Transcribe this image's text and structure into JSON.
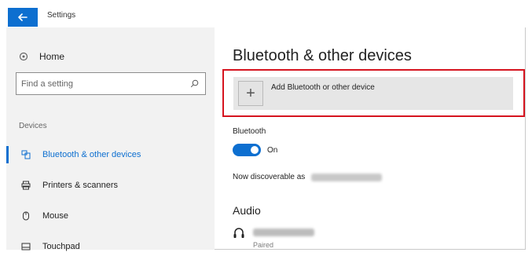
{
  "window": {
    "title": "Settings"
  },
  "sidebar": {
    "home_label": "Home",
    "search": {
      "placeholder": "Find a setting"
    },
    "section_title": "Devices",
    "items": [
      {
        "label": "Bluetooth & other devices",
        "icon": "bluetooth-devices-icon",
        "active": true
      },
      {
        "label": "Printers & scanners",
        "icon": "printer-icon",
        "active": false
      },
      {
        "label": "Mouse",
        "icon": "mouse-icon",
        "active": false
      },
      {
        "label": "Touchpad",
        "icon": "touchpad-icon",
        "active": false
      }
    ]
  },
  "main": {
    "title": "Bluetooth & other devices",
    "add_device_label": "Add Bluetooth or other device",
    "bluetooth": {
      "label": "Bluetooth",
      "toggle_state": "On",
      "discoverable_text": "Now discoverable as"
    },
    "audio": {
      "title": "Audio",
      "device_status": "Paired"
    }
  },
  "colors": {
    "accent": "#0d6fd0",
    "highlight_border": "#d6141f",
    "sidebar_bg": "#f2f2f2",
    "button_bg": "#e6e6e6"
  }
}
